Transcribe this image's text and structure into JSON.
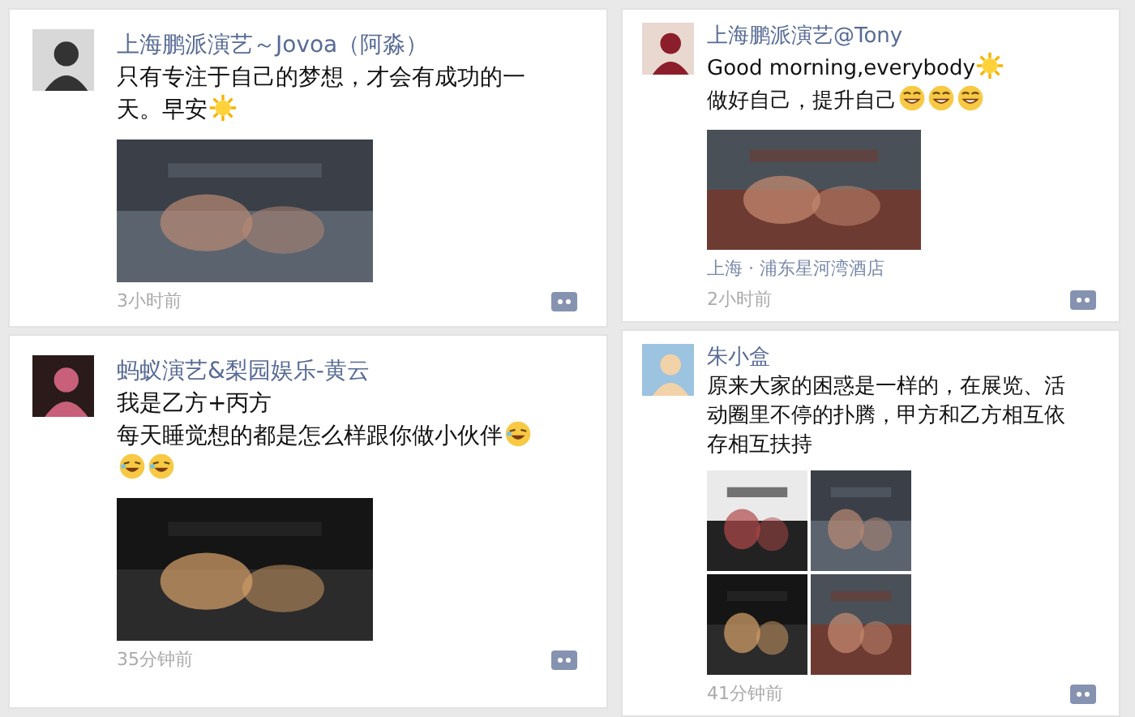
{
  "columns": [
    [
      {
        "name": "上海鹏派演艺～Jovoa（阿淼）",
        "lines": [
          {
            "text": "只有专注于自己的梦想，才会有成功的一"
          },
          {
            "text": "天。早安",
            "emoji": [
              {
                "kind": "sun"
              }
            ]
          }
        ],
        "images": [
          {
            "kind": "picture"
          }
        ],
        "time": "3小时前"
      },
      {
        "name": "蚂蚁演艺&梨园娱乐-黄云",
        "lines": [
          {
            "text": "我是乙方+丙方"
          },
          {
            "text": "每天睡觉想的都是怎么样跟你做小伙伴",
            "emoji": [
              {
                "kind": "laugh"
              },
              {
                "kind": "laugh"
              },
              {
                "kind": "laugh"
              }
            ]
          }
        ],
        "images": [
          {
            "kind": "picture"
          }
        ],
        "time": "35分钟前"
      }
    ],
    [
      {
        "name": "上海鹏派演艺@Tony",
        "lines": [
          {
            "text": "Good morning,everybody",
            "emoji": [
              {
                "kind": "sun"
              }
            ]
          },
          {
            "text": "做好自己，提升自己",
            "emoji": [
              {
                "kind": "cool"
              },
              {
                "kind": "cool"
              },
              {
                "kind": "cool"
              }
            ]
          }
        ],
        "images": [
          {
            "kind": "picture"
          }
        ],
        "location": "上海 · 浦东星河湾酒店",
        "time": "2小时前"
      },
      {
        "name": "朱小盒",
        "lines": [
          {
            "text": "原来大家的困惑是一样的，在展览、活动圈里不停的扑腾，甲方和乙方相互依存相互扶持"
          }
        ],
        "images": [
          {
            "kind": "picture"
          },
          {
            "kind": "picture"
          },
          {
            "kind": "picture"
          },
          {
            "kind": "picture"
          }
        ],
        "time": "41分钟前"
      }
    ]
  ]
}
